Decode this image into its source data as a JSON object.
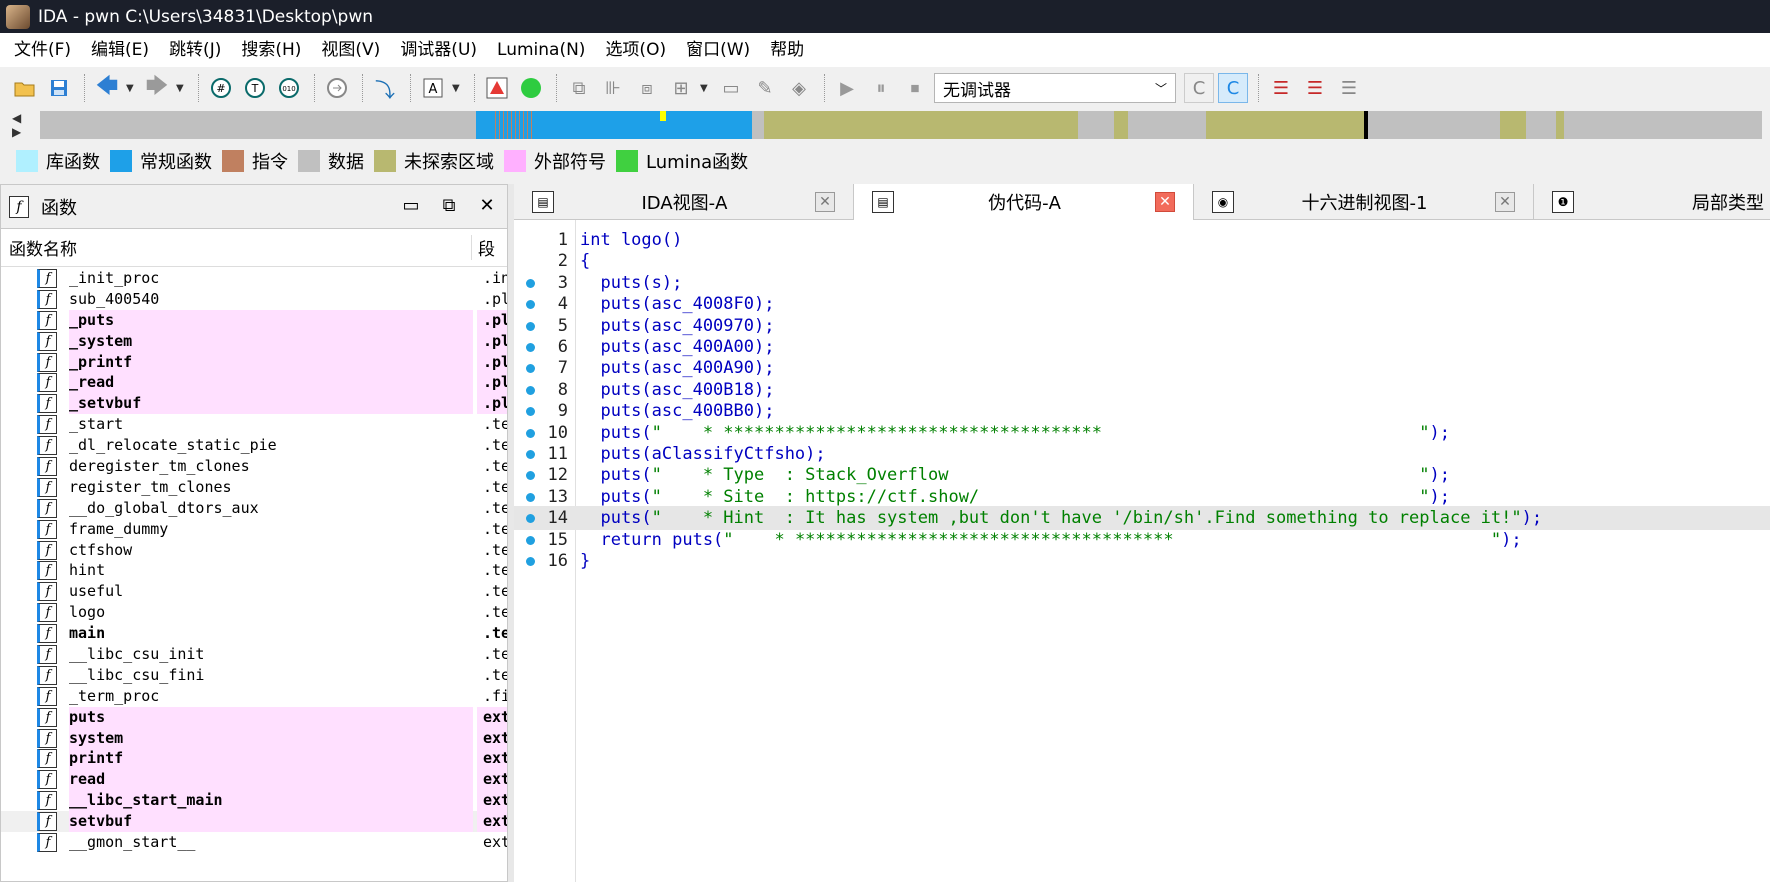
{
  "window": {
    "title": "IDA - pwn C:\\Users\\34831\\Desktop\\pwn"
  },
  "menu": [
    "文件(F)",
    "编辑(E)",
    "跳转(J)",
    "搜索(H)",
    "视图(V)",
    "调试器(U)",
    "Lumina(N)",
    "选项(O)",
    "窗口(W)",
    "帮助"
  ],
  "toolbar": {
    "debugger_select": "无调试器"
  },
  "legend": [
    {
      "label": "库函数",
      "color": "#b0f0ff"
    },
    {
      "label": "常规函数",
      "color": "#1ea0e8"
    },
    {
      "label": "指令",
      "color": "#c08060"
    },
    {
      "label": "数据",
      "color": "#c0c0c0"
    },
    {
      "label": "未探索区域",
      "color": "#b8b870"
    },
    {
      "label": "外部符号",
      "color": "#ffb0ff"
    },
    {
      "label": "Lumina函数",
      "color": "#40d040"
    }
  ],
  "functions_panel": {
    "title": "函数",
    "col_name": "函数名称",
    "col_segment": "段",
    "rows": [
      {
        "name": "_init_proc",
        "seg": ".init"
      },
      {
        "name": "sub_400540",
        "seg": ".plt"
      },
      {
        "name": "_puts",
        "seg": ".plt"
      },
      {
        "name": "_system",
        "seg": ".plt"
      },
      {
        "name": "_printf",
        "seg": ".plt"
      },
      {
        "name": "_read",
        "seg": ".plt"
      },
      {
        "name": "_setvbuf",
        "seg": ".plt"
      },
      {
        "name": "_start",
        "seg": ".text"
      },
      {
        "name": "_dl_relocate_static_pie",
        "seg": ".text"
      },
      {
        "name": "deregister_tm_clones",
        "seg": ".text"
      },
      {
        "name": "register_tm_clones",
        "seg": ".text"
      },
      {
        "name": "__do_global_dtors_aux",
        "seg": ".text"
      },
      {
        "name": "frame_dummy",
        "seg": ".text"
      },
      {
        "name": "ctfshow",
        "seg": ".text"
      },
      {
        "name": "hint",
        "seg": ".text"
      },
      {
        "name": "useful",
        "seg": ".text"
      },
      {
        "name": "logo",
        "seg": ".text"
      },
      {
        "name": "main",
        "seg": ".text"
      },
      {
        "name": "__libc_csu_init",
        "seg": ".text"
      },
      {
        "name": "__libc_csu_fini",
        "seg": ".text"
      },
      {
        "name": "_term_proc",
        "seg": ".fini"
      },
      {
        "name": "puts",
        "seg": "extern"
      },
      {
        "name": "system",
        "seg": "extern"
      },
      {
        "name": "printf",
        "seg": "extern"
      },
      {
        "name": "read",
        "seg": "extern"
      },
      {
        "name": "__libc_start_main",
        "seg": "extern"
      },
      {
        "name": "setvbuf",
        "seg": "extern"
      },
      {
        "name": "__gmon_start__",
        "seg": "extern"
      }
    ]
  },
  "tabs": [
    {
      "label": "IDA视图-A"
    },
    {
      "label": "伪代码-A"
    },
    {
      "label": "十六进制视图-1"
    },
    {
      "label": "局部类型"
    }
  ],
  "code": [
    {
      "n": "1",
      "text": "int logo()"
    },
    {
      "n": "2",
      "text": "{"
    },
    {
      "n": "3",
      "text": "  puts(s);"
    },
    {
      "n": "4",
      "text": "  puts(asc_4008F0);"
    },
    {
      "n": "5",
      "text": "  puts(asc_400970);"
    },
    {
      "n": "6",
      "text": "  puts(asc_400A00);"
    },
    {
      "n": "7",
      "text": "  puts(asc_400A90);"
    },
    {
      "n": "8",
      "text": "  puts(asc_400B18);"
    },
    {
      "n": "9",
      "text": "  puts(asc_400BB0);"
    },
    {
      "n": "10",
      "pre": "  puts(",
      "str": "\"    * *************************************                               \"",
      "post": ");"
    },
    {
      "n": "11",
      "text": "  puts(aClassifyCtfsho);"
    },
    {
      "n": "12",
      "pre": "  puts(",
      "str": "\"    * Type  : Stack_Overflow                                              \"",
      "post": ");"
    },
    {
      "n": "13",
      "pre": "  puts(",
      "str": "\"    * Site  : https://ctf.show/                                           \"",
      "post": ");"
    },
    {
      "n": "14",
      "pre": "  puts(",
      "str": "\"    * Hint  : It has system ,but don't have '/bin/sh'.Find something to replace it!\"",
      "post": ");"
    },
    {
      "n": "15",
      "pre": "  return puts(",
      "str": "\"    * *************************************                               \"",
      "post": ");"
    },
    {
      "n": "16",
      "text": "}"
    }
  ]
}
